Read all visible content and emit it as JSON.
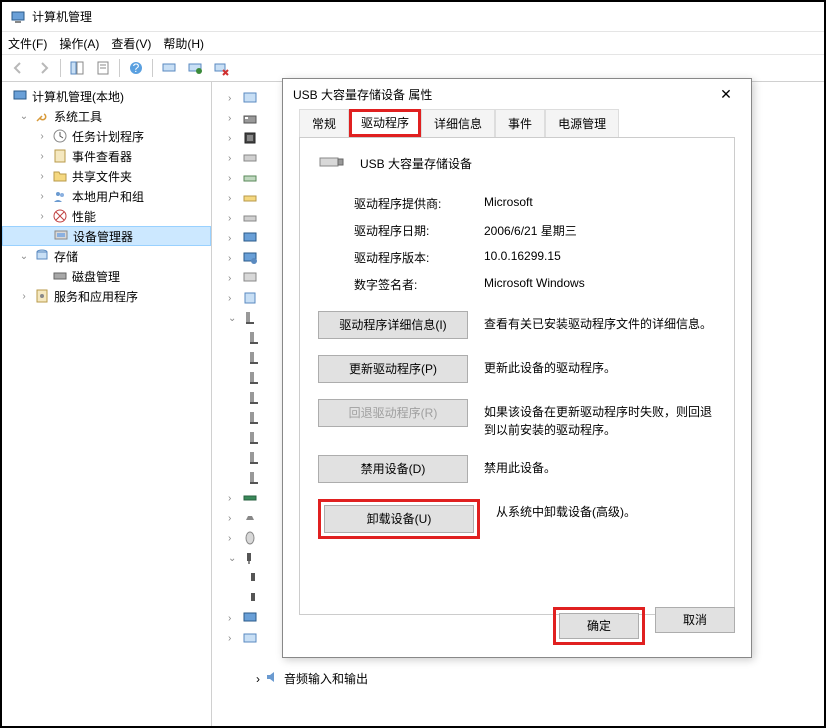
{
  "window": {
    "title": "计算机管理"
  },
  "menu": {
    "file": "文件(F)",
    "action": "操作(A)",
    "view": "查看(V)",
    "help": "帮助(H)"
  },
  "tree": {
    "root": "计算机管理(本地)",
    "systools": "系统工具",
    "sched": "任务计划程序",
    "event": "事件查看器",
    "share": "共享文件夹",
    "users": "本地用户和组",
    "perf": "性能",
    "devmgr": "设备管理器",
    "storage": "存储",
    "disk": "磁盘管理",
    "services": "服务和应用程序"
  },
  "audio_line": "音频输入和输出",
  "dialog": {
    "title": "USB 大容量存储设备 属性",
    "tabs": {
      "general": "常规",
      "driver": "驱动程序",
      "details": "详细信息",
      "events": "事件",
      "power": "电源管理"
    },
    "device_name": "USB 大容量存储设备",
    "info": {
      "provider_k": "驱动程序提供商:",
      "provider_v": "Microsoft",
      "date_k": "驱动程序日期:",
      "date_v": "2006/6/21 星期三",
      "version_k": "驱动程序版本:",
      "version_v": "10.0.16299.15",
      "signer_k": "数字签名者:",
      "signer_v": "Microsoft Windows"
    },
    "buttons": {
      "details": "驱动程序详细信息(I)",
      "details_d": "查看有关已安装驱动程序文件的详细信息。",
      "update": "更新驱动程序(P)",
      "update_d": "更新此设备的驱动程序。",
      "rollback": "回退驱动程序(R)",
      "rollback_d": "如果该设备在更新驱动程序时失败，则回退到以前安装的驱动程序。",
      "disable": "禁用设备(D)",
      "disable_d": "禁用此设备。",
      "uninstall": "卸载设备(U)",
      "uninstall_d": "从系统中卸载设备(高级)。"
    },
    "ok": "确定",
    "cancel": "取消"
  }
}
